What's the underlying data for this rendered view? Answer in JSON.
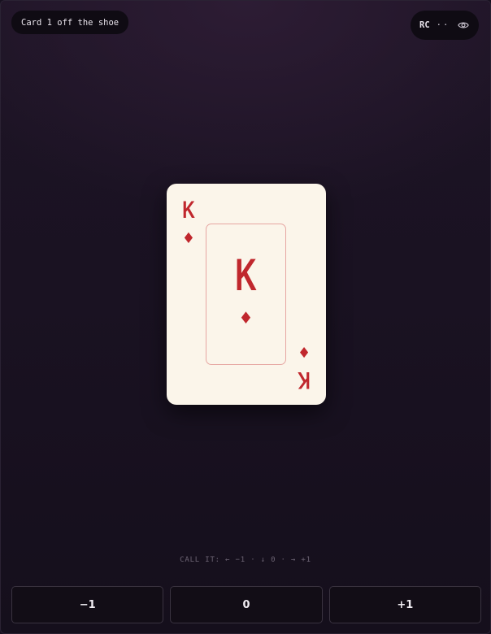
{
  "header": {
    "shoe_status": "Card 1 off the shoe",
    "running_count_label": "RC",
    "running_count_masked": "··",
    "reveal_icon": "eye-icon"
  },
  "card": {
    "rank": "K",
    "suit": "♦",
    "suit_name": "diamonds",
    "color": "#c0272d",
    "face_color": "#fbf5ea"
  },
  "hint": "CALL IT: ← −1 · ↓ 0 · → +1",
  "buttons": [
    {
      "label": "−1"
    },
    {
      "label": "0"
    },
    {
      "label": "+1"
    }
  ]
}
